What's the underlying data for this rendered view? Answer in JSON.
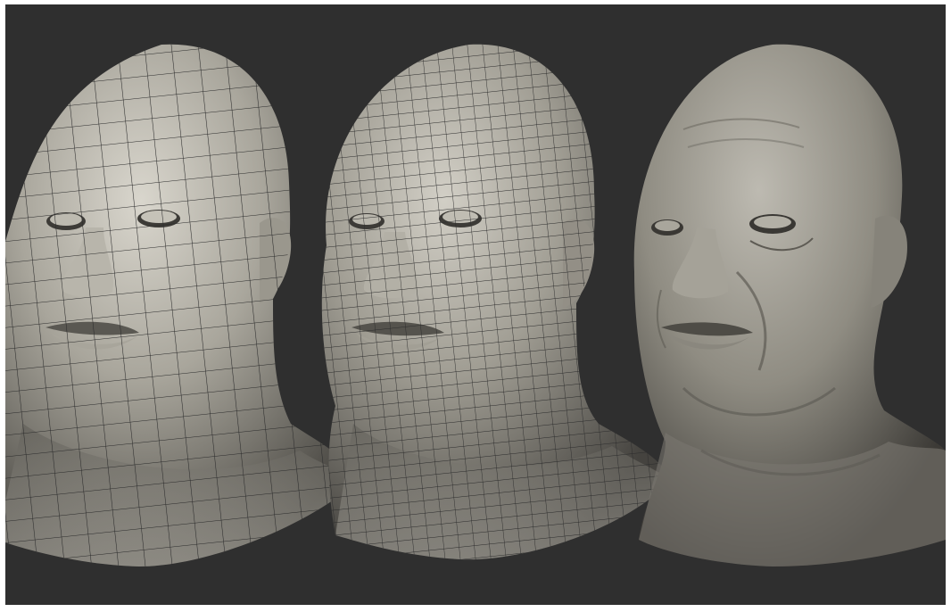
{
  "scene": {
    "background_color": "#2f2f2f",
    "border_color": "#ffffff",
    "clay_color": "#8f8c82",
    "wire_color": "#2b2b2b",
    "subjects": [
      {
        "name": "low-resolution-wireframe-head",
        "wireframe": true,
        "mesh_density": "coarse"
      },
      {
        "name": "subdivided-wireframe-head",
        "wireframe": true,
        "mesh_density": "fine"
      },
      {
        "name": "sculpted-detailed-head",
        "wireframe": false,
        "mesh_density": "none"
      }
    ]
  }
}
